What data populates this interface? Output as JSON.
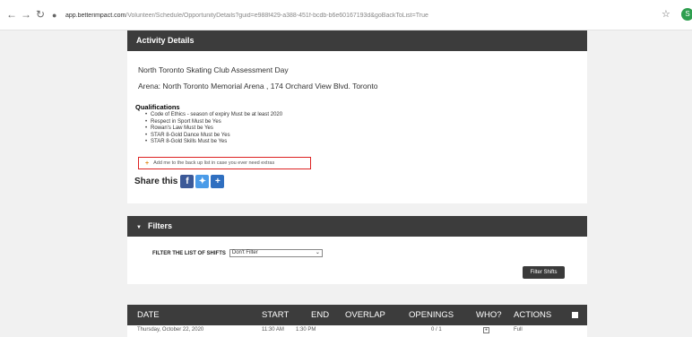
{
  "browser": {
    "url_host": "app.betterimpact.com",
    "url_path": "/Volunteer/Schedule/OpportunityDetails?guid=e988f429-a388-451f-bcdb-b6e60167193d&goBackToList=True"
  },
  "activity": {
    "header": "Activity Details",
    "title": "North Toronto Skating Club Assessment Day",
    "location": "Arena: North Toronto Memorial Arena , 174 Orchard View Blvd. Toronto",
    "qualifications_title": "Qualifications",
    "qualifications": [
      "Code of Ethics - season of expiry Must be at least 2020",
      "Respect in Sport Must be Yes",
      "Rowan's Law Must be Yes",
      "STAR 8-Gold Dance Must be Yes",
      "STAR 8-Gold Skills Must be Yes"
    ],
    "backup_label": "Add me to the back up list in case you ever need extras",
    "share_label": "Share this"
  },
  "filters": {
    "header": "Filters",
    "filter_label": "FILTER THE LIST OF SHIFTS",
    "filter_value": "Don't Filter",
    "filter_button": "Filter Shifts"
  },
  "shifts": {
    "columns": {
      "date": "DATE",
      "start": "START",
      "end": "END",
      "overlap": "OVERLAP",
      "openings": "OPENINGS",
      "who": "WHO?",
      "actions": "ACTIONS"
    },
    "rows": [
      {
        "date": "Thursday, October 22, 2020",
        "start": "11:30 AM",
        "end": "1:30 PM",
        "overlap": "",
        "openings": "0 / 1",
        "action": "Full"
      }
    ]
  },
  "colors": {
    "header_bg": "#3c3c3c",
    "backup_border": "#dd2222",
    "facebook": "#3b5998",
    "twitter": "#4a9be8"
  },
  "icons": {
    "back": "back-arrow-icon",
    "forward": "forward-arrow-icon",
    "reload": "reload-icon",
    "lock": "lock-icon",
    "star": "star-icon",
    "profile": "profile-icon"
  }
}
